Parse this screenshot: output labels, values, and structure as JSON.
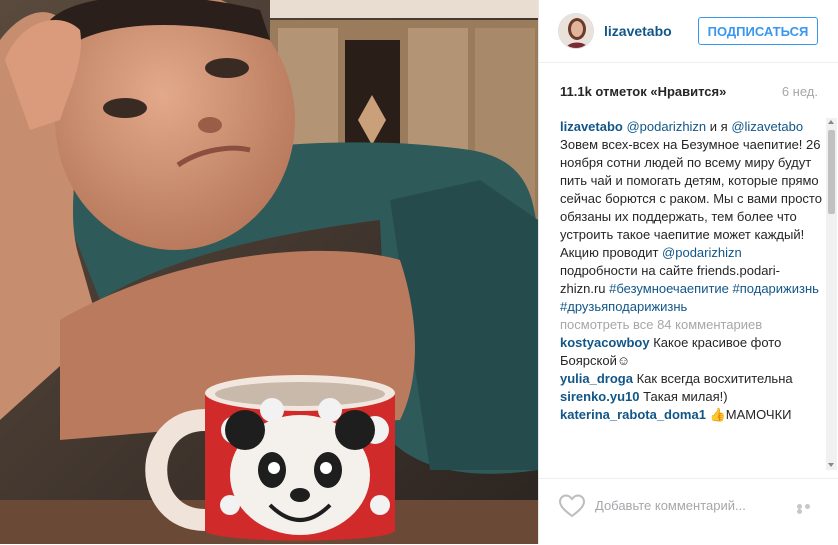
{
  "post": {
    "username": "lizavetabo",
    "follow_label": "ПОДПИСАТЬСЯ",
    "likes": "11.1k отметок «Нравится»",
    "time": "6 нед."
  },
  "caption": {
    "user": "lizavetabo",
    "mention1": "@podarizhizn",
    "and_text": " и я ",
    "mention2": "@lizavetabo",
    "body": "Зовем всех-всех на Безумное чаепитие! 26 ноября сотни людей по всему миру будут пить чай и помогать детям, которые прямо сейчас борются с раком. Мы с вами просто обязаны их поддержать, тем более что устроить такое чаепитие может каждый! Акцию проводит ",
    "mention3": "@podarizhizn",
    "tail": " подробности на сайте friends.podari-zhizn.ru ",
    "hashtags": "#безумноечаепитие #подарижизнь #друзьяподарижизнь"
  },
  "comments_link": "посмотреть все 84 комментариев",
  "comments": [
    {
      "user": "kostyacowboy",
      "text": "Какое красивое фото Боярской☺"
    },
    {
      "user": "yulia_droga",
      "text": "Как всегда восхитительна"
    },
    {
      "user": "sirenko.yu10",
      "text": "Такая милая!)"
    },
    {
      "user": "katerina_rabota_doma1",
      "text": "👍МАМОЧКИ"
    }
  ],
  "footer": {
    "add_comment": "Добавьте комментарий..."
  },
  "icons": {
    "like": "heart-icon",
    "options": "more-options-icon"
  },
  "colors": {
    "link": "#125688",
    "button": "#3897f0",
    "muted": "#a5a7aa"
  }
}
